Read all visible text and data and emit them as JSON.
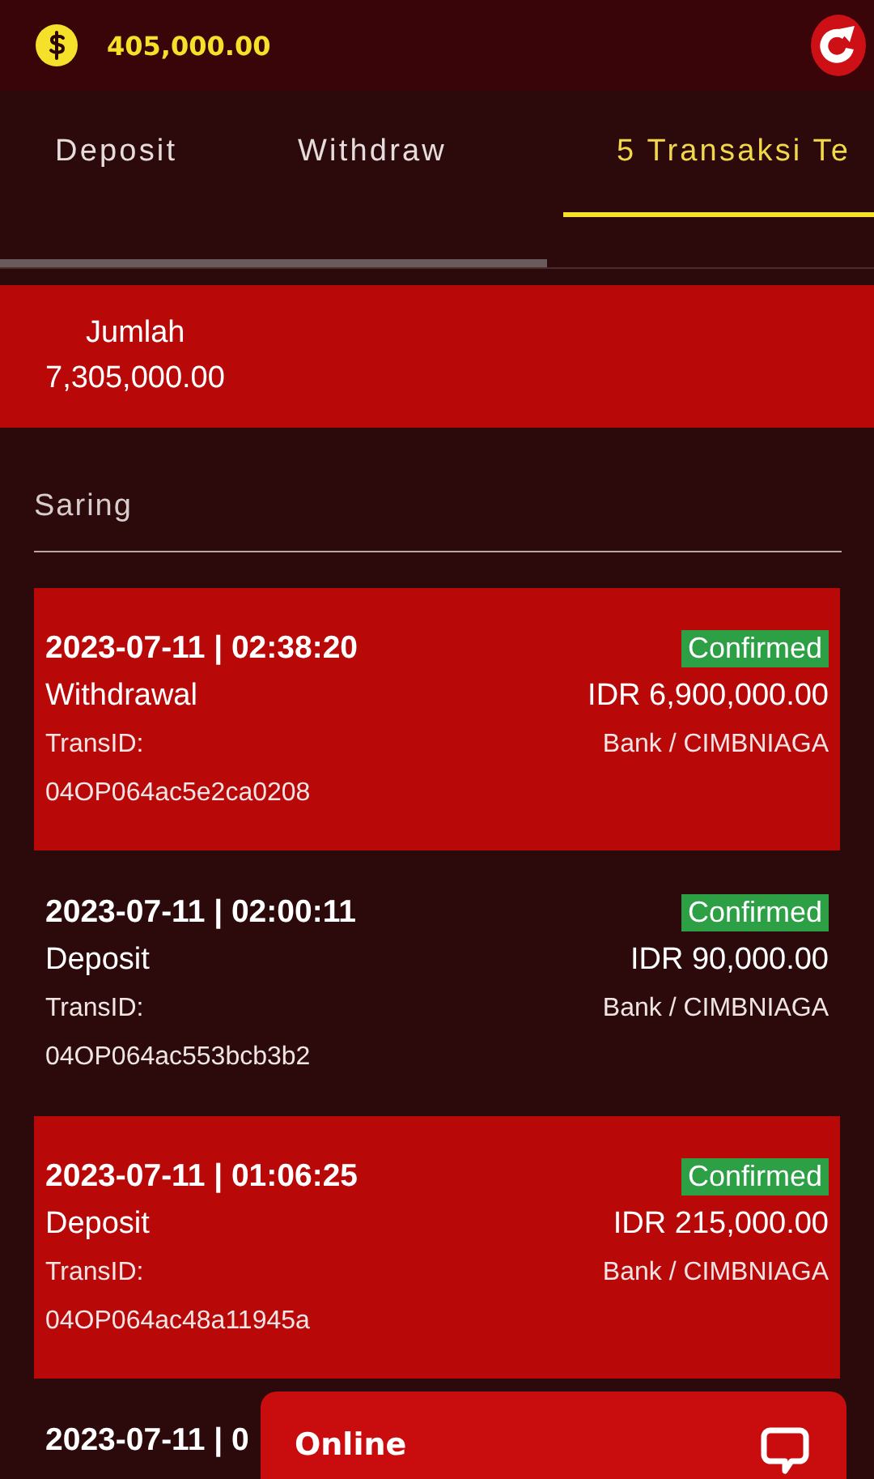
{
  "header": {
    "balance": "405,000.00"
  },
  "tabs": [
    {
      "label": "Deposit",
      "selected": false
    },
    {
      "label": "Withdraw",
      "selected": false
    },
    {
      "label": "5 Transaksi Te",
      "selected": true
    }
  ],
  "total": {
    "label": "Jumlah",
    "value": "7,305,000.00"
  },
  "filter": {
    "label": "Saring"
  },
  "transactions": [
    {
      "highlighted": true,
      "datetime": "2023-07-11 | 02:38:20",
      "status": "Confirmed",
      "type": "Withdrawal",
      "amount": "IDR 6,900,000.00",
      "id_label": "TransID:",
      "method": "Bank / CIMBNIAGA",
      "trans_id": "04OP064ac5e2ca0208"
    },
    {
      "highlighted": false,
      "datetime": "2023-07-11 | 02:00:11",
      "status": "Confirmed",
      "type": "Deposit",
      "amount": "IDR 90,000.00",
      "id_label": "TransID:",
      "method": "Bank / CIMBNIAGA",
      "trans_id": "04OP064ac553bcb3b2"
    },
    {
      "highlighted": true,
      "datetime": "2023-07-11 | 01:06:25",
      "status": "Confirmed",
      "type": "Deposit",
      "amount": "IDR 215,000.00",
      "id_label": "TransID:",
      "method": "Bank / CIMBNIAGA",
      "trans_id": "04OP064ac48a11945a"
    },
    {
      "highlighted": false,
      "datetime": "2023-07-11 | 0"
    }
  ],
  "chat": {
    "label": "Online"
  }
}
